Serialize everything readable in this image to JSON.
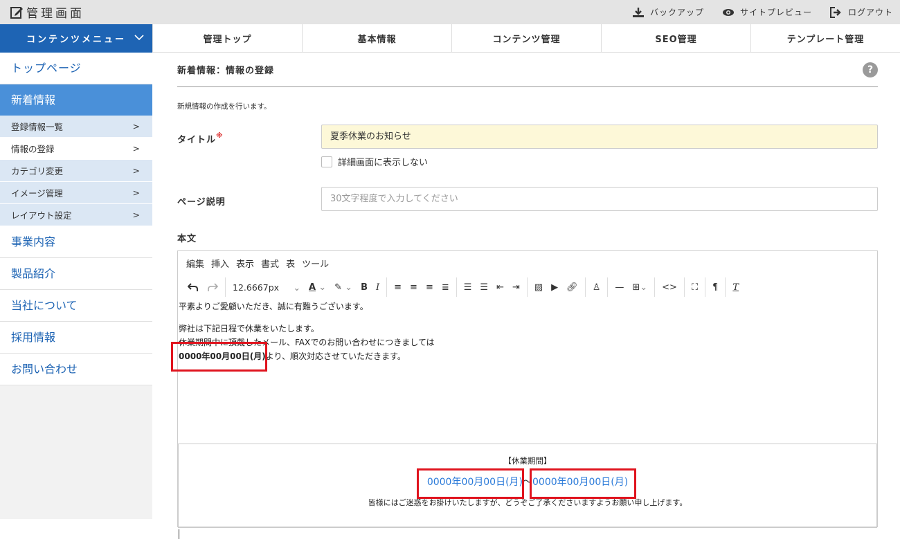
{
  "app": {
    "title": "管理画面"
  },
  "top_actions": [
    {
      "label": "バックアップ",
      "icon": "download-icon"
    },
    {
      "label": "サイトプレビュー",
      "icon": "eye-icon"
    },
    {
      "label": "ログアウト",
      "icon": "logout-icon"
    }
  ],
  "menu_toggle": {
    "label": "コンテンツメニュー"
  },
  "tabs": [
    "管理トップ",
    "基本情報",
    "コンテンツ管理",
    "SEO管理",
    "テンプレート管理"
  ],
  "sidebar": {
    "top": "トップページ",
    "active": "新着情報",
    "sub_items": [
      "登録情報一覧",
      "情報の登録",
      "カテゴリ変更",
      "イメージ管理",
      "レイアウト設定"
    ],
    "items": [
      "事業内容",
      "製品紹介",
      "当社について",
      "採用情報",
      "お問い合わせ"
    ]
  },
  "page": {
    "heading": "新着情報：情報の登録",
    "help": "?",
    "description": "新規情報の作成を行います。"
  },
  "form": {
    "title_label": "タイトル",
    "required_mark": "※",
    "title_value": "夏季休業のお知らせ",
    "hide_detail_label": "詳細画面に表示しない",
    "page_desc_label": "ページ説明",
    "page_desc_placeholder": "30文字程度で入力してください",
    "body_label": "本文"
  },
  "editor": {
    "menu": [
      "編集",
      "挿入",
      "表示",
      "書式",
      "表",
      "ツール"
    ],
    "font_size": "12.6667px",
    "lines": [
      "平素よりご愛顧いただき、誠に有難うございます。",
      "弊社は下記日程で休業をいたします。",
      "休業期間中に頂戴したメール、FAXでのお問い合わせにつきましては",
      "0000年00月00日(月)",
      "より、順次対応させていただきます。"
    ],
    "notice": {
      "title": "【休業期間】",
      "date_start": "0000年00月00日(月)",
      "separator": "〜",
      "date_end": "0000年00月00日(月)",
      "message": "皆様にはご迷惑をお掛けいたしますが、どうぞご了承くださいますようお願い申し上げます。"
    }
  },
  "colors": {
    "primary": "#1e64b4",
    "active": "#4a90d9",
    "highlight": "#e0141e",
    "link": "#2a7ad9"
  }
}
